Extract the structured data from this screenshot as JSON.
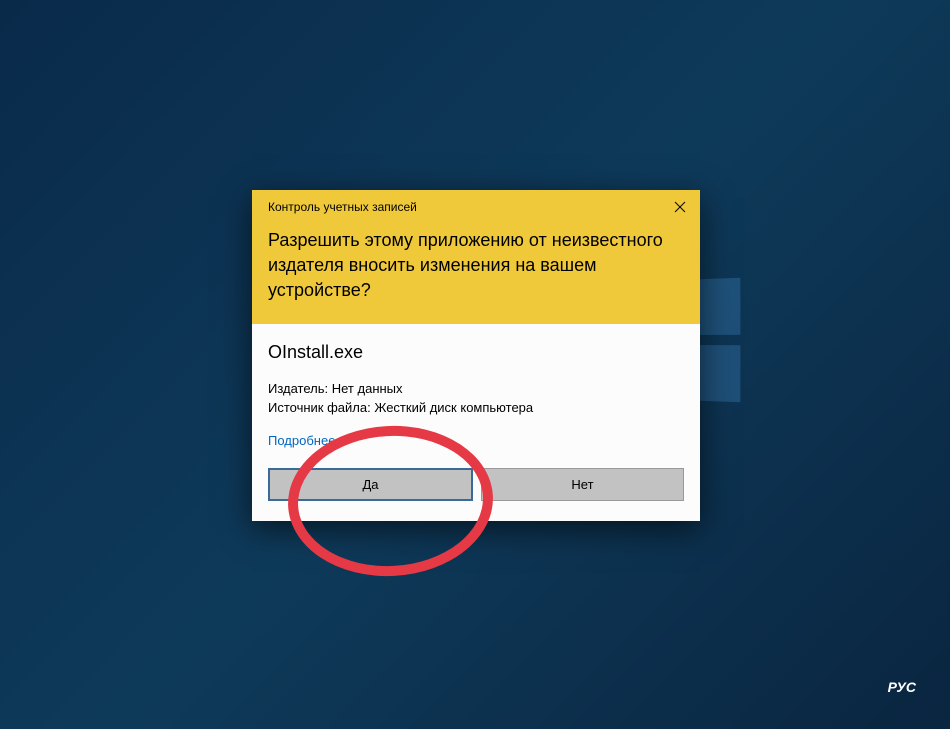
{
  "uac": {
    "title_small": "Контроль учетных записей",
    "title_main": "Разрешить этому приложению от неизвестного издателя вносить изменения на вашем устройстве?",
    "app_name": "OInstall.exe",
    "publisher_label": "Издатель:",
    "publisher_value": "Нет данных",
    "source_label": "Источник файла:",
    "source_value": "Жесткий диск компьютера",
    "details_link": "Подробнее",
    "yes_button": "Да",
    "no_button": "Нет"
  },
  "taskbar": {
    "language": "РУС"
  }
}
